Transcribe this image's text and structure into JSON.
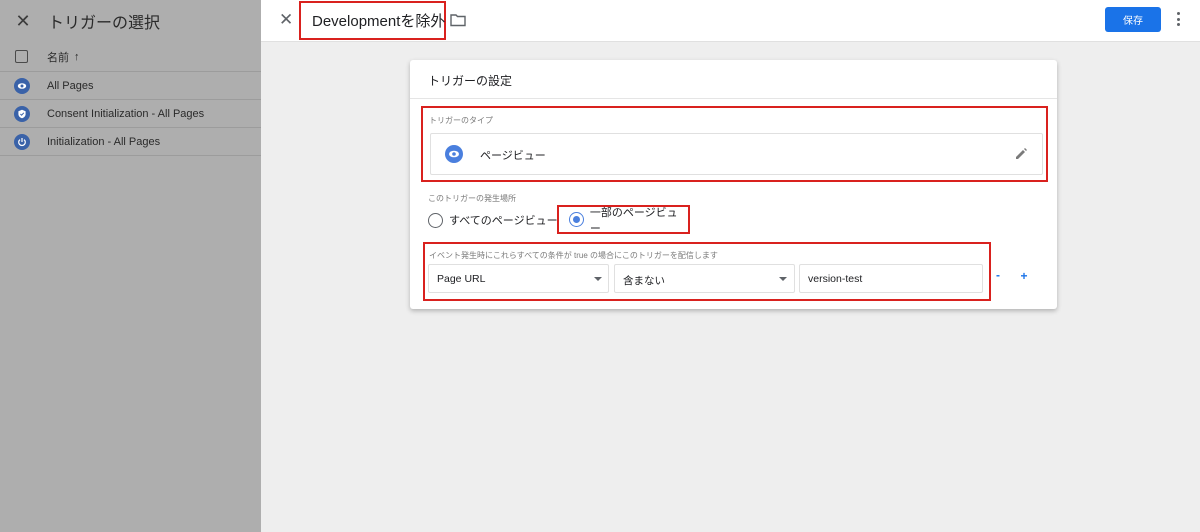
{
  "left_panel": {
    "title": "トリガーの選択",
    "column_header": "名前",
    "sort_arrow": "↑",
    "rows": [
      {
        "label": "All Pages",
        "icon": "eye-icon"
      },
      {
        "label": "Consent Initialization - All Pages",
        "icon": "shield-icon"
      },
      {
        "label": "Initialization - All Pages",
        "icon": "power-icon"
      }
    ]
  },
  "editor": {
    "title": "Developmentを除外",
    "save_label": "保存",
    "card": {
      "title": "トリガーの設定",
      "trigger_type_label": "トリガーのタイプ",
      "trigger_type_value": "ページビュー",
      "fire_on_label": "このトリガーの発生場所",
      "radio_all_label": "すべてのページビュー",
      "radio_some_label": "一部のページビュー",
      "selected_radio": "一部のページビュー",
      "condition_label": "イベント発生時にこれらすべての条件が true の場合にこのトリガーを配信します",
      "condition": {
        "variable": "Page URL",
        "operator": "含まない",
        "value": "version-test"
      },
      "minus_label": "-",
      "plus_label": "+"
    }
  },
  "colors": {
    "accent": "#1a73e8",
    "highlight_box": "#d9211e",
    "icon_blue": "#4a7fde",
    "overlay_gray": "#aeaeae"
  }
}
